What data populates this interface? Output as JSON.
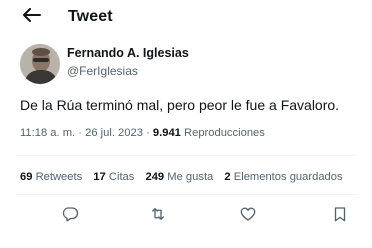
{
  "header": {
    "title": "Tweet",
    "back_icon": "arrow-left-icon"
  },
  "author": {
    "name": "Fernando A. Iglesias",
    "handle": "@FerIglesias",
    "avatar": "profile-photo"
  },
  "tweet": {
    "text": "De la Rúa terminó mal, pero peor le fue a Favaloro."
  },
  "meta": {
    "time": "11:18 a. m.",
    "separator": "·",
    "date": "26 jul. 2023",
    "views_count": "9.941",
    "views_label": "Reproducciones"
  },
  "stats": {
    "retweets_count": "69",
    "retweets_label": "Retweets",
    "quotes_count": "17",
    "quotes_label": "Citas",
    "likes_count": "249",
    "likes_label": "Me gusta",
    "bookmarks_count": "2",
    "bookmarks_label": "Elementos guardados"
  },
  "actions": [
    "reply-icon",
    "retweet-icon",
    "like-icon",
    "bookmark-icon"
  ],
  "colors": {
    "text": "#0f1419",
    "secondary": "#536471",
    "divider": "#eff3f4"
  }
}
